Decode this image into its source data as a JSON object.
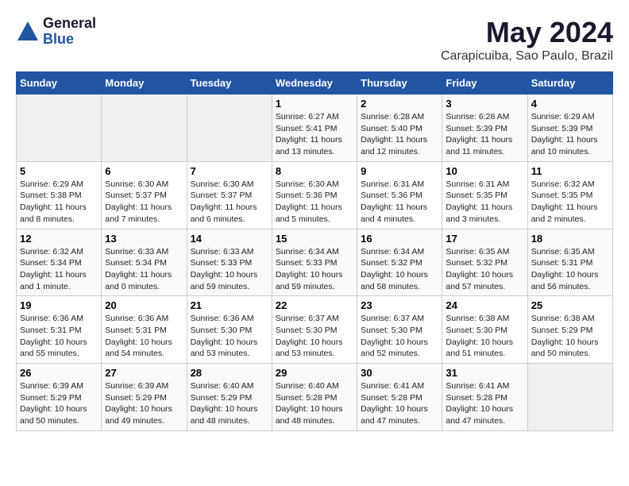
{
  "logo": {
    "general": "General",
    "blue": "Blue",
    "tagline": ""
  },
  "title": "May 2024",
  "subtitle": "Carapicuiba, Sao Paulo, Brazil",
  "days_of_week": [
    "Sunday",
    "Monday",
    "Tuesday",
    "Wednesday",
    "Thursday",
    "Friday",
    "Saturday"
  ],
  "weeks": [
    [
      {
        "day": "",
        "info": ""
      },
      {
        "day": "",
        "info": ""
      },
      {
        "day": "",
        "info": ""
      },
      {
        "day": "1",
        "info": "Sunrise: 6:27 AM\nSunset: 5:41 PM\nDaylight: 11 hours and 13 minutes."
      },
      {
        "day": "2",
        "info": "Sunrise: 6:28 AM\nSunset: 5:40 PM\nDaylight: 11 hours and 12 minutes."
      },
      {
        "day": "3",
        "info": "Sunrise: 6:28 AM\nSunset: 5:39 PM\nDaylight: 11 hours and 11 minutes."
      },
      {
        "day": "4",
        "info": "Sunrise: 6:29 AM\nSunset: 5:39 PM\nDaylight: 11 hours and 10 minutes."
      }
    ],
    [
      {
        "day": "5",
        "info": "Sunrise: 6:29 AM\nSunset: 5:38 PM\nDaylight: 11 hours and 8 minutes."
      },
      {
        "day": "6",
        "info": "Sunrise: 6:30 AM\nSunset: 5:37 PM\nDaylight: 11 hours and 7 minutes."
      },
      {
        "day": "7",
        "info": "Sunrise: 6:30 AM\nSunset: 5:37 PM\nDaylight: 11 hours and 6 minutes."
      },
      {
        "day": "8",
        "info": "Sunrise: 6:30 AM\nSunset: 5:36 PM\nDaylight: 11 hours and 5 minutes."
      },
      {
        "day": "9",
        "info": "Sunrise: 6:31 AM\nSunset: 5:36 PM\nDaylight: 11 hours and 4 minutes."
      },
      {
        "day": "10",
        "info": "Sunrise: 6:31 AM\nSunset: 5:35 PM\nDaylight: 11 hours and 3 minutes."
      },
      {
        "day": "11",
        "info": "Sunrise: 6:32 AM\nSunset: 5:35 PM\nDaylight: 11 hours and 2 minutes."
      }
    ],
    [
      {
        "day": "12",
        "info": "Sunrise: 6:32 AM\nSunset: 5:34 PM\nDaylight: 11 hours and 1 minute."
      },
      {
        "day": "13",
        "info": "Sunrise: 6:33 AM\nSunset: 5:34 PM\nDaylight: 11 hours and 0 minutes."
      },
      {
        "day": "14",
        "info": "Sunrise: 6:33 AM\nSunset: 5:33 PM\nDaylight: 10 hours and 59 minutes."
      },
      {
        "day": "15",
        "info": "Sunrise: 6:34 AM\nSunset: 5:33 PM\nDaylight: 10 hours and 59 minutes."
      },
      {
        "day": "16",
        "info": "Sunrise: 6:34 AM\nSunset: 5:32 PM\nDaylight: 10 hours and 58 minutes."
      },
      {
        "day": "17",
        "info": "Sunrise: 6:35 AM\nSunset: 5:32 PM\nDaylight: 10 hours and 57 minutes."
      },
      {
        "day": "18",
        "info": "Sunrise: 6:35 AM\nSunset: 5:31 PM\nDaylight: 10 hours and 56 minutes."
      }
    ],
    [
      {
        "day": "19",
        "info": "Sunrise: 6:36 AM\nSunset: 5:31 PM\nDaylight: 10 hours and 55 minutes."
      },
      {
        "day": "20",
        "info": "Sunrise: 6:36 AM\nSunset: 5:31 PM\nDaylight: 10 hours and 54 minutes."
      },
      {
        "day": "21",
        "info": "Sunrise: 6:36 AM\nSunset: 5:30 PM\nDaylight: 10 hours and 53 minutes."
      },
      {
        "day": "22",
        "info": "Sunrise: 6:37 AM\nSunset: 5:30 PM\nDaylight: 10 hours and 53 minutes."
      },
      {
        "day": "23",
        "info": "Sunrise: 6:37 AM\nSunset: 5:30 PM\nDaylight: 10 hours and 52 minutes."
      },
      {
        "day": "24",
        "info": "Sunrise: 6:38 AM\nSunset: 5:30 PM\nDaylight: 10 hours and 51 minutes."
      },
      {
        "day": "25",
        "info": "Sunrise: 6:38 AM\nSunset: 5:29 PM\nDaylight: 10 hours and 50 minutes."
      }
    ],
    [
      {
        "day": "26",
        "info": "Sunrise: 6:39 AM\nSunset: 5:29 PM\nDaylight: 10 hours and 50 minutes."
      },
      {
        "day": "27",
        "info": "Sunrise: 6:39 AM\nSunset: 5:29 PM\nDaylight: 10 hours and 49 minutes."
      },
      {
        "day": "28",
        "info": "Sunrise: 6:40 AM\nSunset: 5:29 PM\nDaylight: 10 hours and 48 minutes."
      },
      {
        "day": "29",
        "info": "Sunrise: 6:40 AM\nSunset: 5:28 PM\nDaylight: 10 hours and 48 minutes."
      },
      {
        "day": "30",
        "info": "Sunrise: 6:41 AM\nSunset: 5:28 PM\nDaylight: 10 hours and 47 minutes."
      },
      {
        "day": "31",
        "info": "Sunrise: 6:41 AM\nSunset: 5:28 PM\nDaylight: 10 hours and 47 minutes."
      },
      {
        "day": "",
        "info": ""
      }
    ]
  ],
  "colors": {
    "header_bg": "#2255a4",
    "header_text": "#ffffff",
    "title_color": "#1a1a2e",
    "logo_blue": "#2255a4"
  }
}
